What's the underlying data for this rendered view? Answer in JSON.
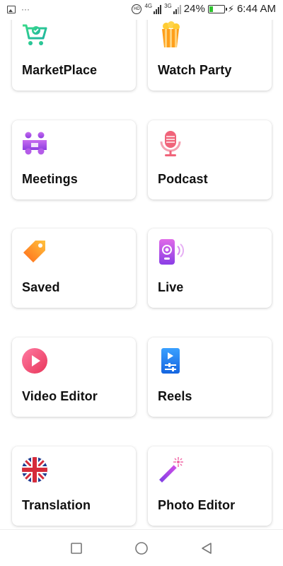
{
  "status_bar": {
    "left_icons": [
      "image-icon",
      "more-dots-icon"
    ],
    "more_text": "···",
    "hd_label": "HD",
    "sim1_network": "4G",
    "sim2_network": "3G",
    "battery_percent": "24%",
    "battery_level": 0.24,
    "time": "6:44 AM"
  },
  "cards": [
    {
      "label": "MarketPlace",
      "icon": "shopping-cart-icon"
    },
    {
      "label": "Watch Party",
      "icon": "popcorn-icon"
    },
    {
      "label": "Meetings",
      "icon": "meeting-people-icon"
    },
    {
      "label": "Podcast",
      "icon": "microphone-icon"
    },
    {
      "label": "Saved",
      "icon": "tag-icon"
    },
    {
      "label": "Live",
      "icon": "live-phone-icon"
    },
    {
      "label": "Video Editor",
      "icon": "play-circle-icon"
    },
    {
      "label": "Reels",
      "icon": "reels-icon"
    },
    {
      "label": "Translation",
      "icon": "uk-flag-icon"
    },
    {
      "label": "Photo Editor",
      "icon": "magic-wand-icon"
    }
  ],
  "colors": {
    "accent_green": "#2ecc8f",
    "accent_purple": "#8e44e8",
    "accent_pink": "#f0506e",
    "accent_blue": "#1e88e5"
  },
  "nav": [
    "recent-apps-icon",
    "home-icon",
    "back-icon"
  ]
}
